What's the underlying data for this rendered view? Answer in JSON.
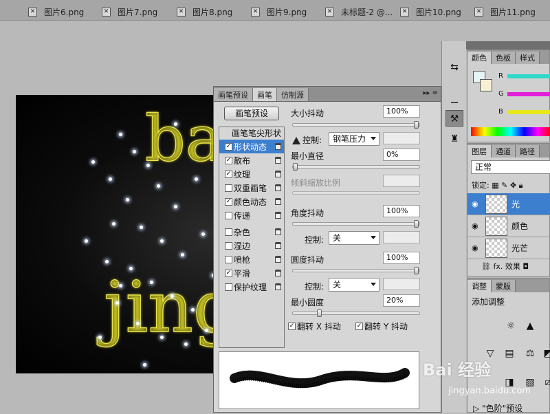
{
  "tabs": [
    {
      "label": "图片6.png"
    },
    {
      "label": "图片7.png"
    },
    {
      "label": "图片8.png"
    },
    {
      "label": "图片9.png"
    },
    {
      "label": "未标题-2 @..."
    },
    {
      "label": "图片10.png"
    },
    {
      "label": "图片11.png"
    }
  ],
  "canvas": {
    "text_top": "bai",
    "text_bottom": "jing"
  },
  "brush_panel": {
    "tabs": [
      "画笔预设",
      "画笔",
      "仿制源"
    ],
    "active_tab": "画笔",
    "menu_glyph": "▸▸ ≡",
    "preset_button": "画笔预设",
    "list_header": "画笔笔尖形状",
    "items": [
      {
        "label": "形状动态",
        "checked": true,
        "selected": true
      },
      {
        "label": "散布",
        "checked": true,
        "selected": false
      },
      {
        "label": "纹理",
        "checked": true,
        "selected": false
      },
      {
        "label": "双重画笔",
        "checked": false,
        "selected": false
      },
      {
        "label": "颜色动态",
        "checked": true,
        "selected": false
      },
      {
        "label": "传递",
        "checked": false,
        "selected": false
      },
      {
        "label": "杂色",
        "checked": false,
        "selected": false
      },
      {
        "label": "湿边",
        "checked": false,
        "selected": false
      },
      {
        "label": "喷枪",
        "checked": false,
        "selected": false
      },
      {
        "label": "平滑",
        "checked": true,
        "selected": false
      },
      {
        "label": "保护纹理",
        "checked": false,
        "selected": false
      }
    ],
    "size_jitter": {
      "label": "大小抖动",
      "value": "100%",
      "slider": 1.0
    },
    "control1": {
      "label": "控制:",
      "value": "钢笔压力"
    },
    "min_diameter": {
      "label": "最小直径",
      "value": "0%",
      "slider": 0.0
    },
    "tilt_scale": {
      "label": "倾斜缩放比例"
    },
    "angle_jitter": {
      "label": "角度抖动",
      "value": "100%",
      "slider": 1.0
    },
    "control2": {
      "label": "控制:",
      "value": "关"
    },
    "roundness_jitter": {
      "label": "圆度抖动",
      "value": "100%",
      "slider": 1.0
    },
    "control3": {
      "label": "控制:",
      "value": "关"
    },
    "min_roundness": {
      "label": "最小圆度",
      "value": "20%",
      "slider": 0.2
    },
    "flip_x": {
      "label": "翻转 X 抖动",
      "checked": true
    },
    "flip_y": {
      "label": "翻转 Y 抖动",
      "checked": true
    }
  },
  "color_panel": {
    "tabs": [
      "颜色",
      "色板",
      "样式"
    ],
    "r": "R",
    "g": "G",
    "b": "B",
    "r_color": "#2fd9c8",
    "g_color": "#e21fd8",
    "b_color": "#e7e81a"
  },
  "layers_panel": {
    "tabs": [
      "图层",
      "通道",
      "路径"
    ],
    "blend_mode": "正常",
    "lock_label": "锁定:",
    "layers": [
      {
        "name": "光",
        "selected": true
      },
      {
        "name": "颜色",
        "selected": false
      },
      {
        "name": "光芒",
        "selected": false
      }
    ],
    "footer_text": "效果",
    "fx": "fx."
  },
  "adjust_panel": {
    "tabs": [
      "调整",
      "蒙版"
    ],
    "title": "添加调整",
    "preset": "\"色阶\"预设"
  },
  "watermark": {
    "text": "Bai 经验",
    "sub": "jingyan.baidu.com"
  }
}
